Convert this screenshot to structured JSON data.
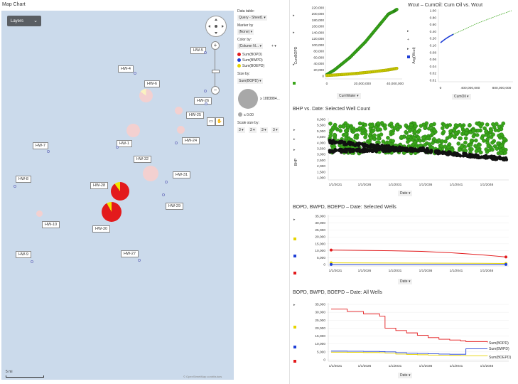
{
  "map": {
    "title": "Map Chart",
    "layers_label": "Layers",
    "scale_label": "5 mi",
    "credit": "© OpenStreetMap contributors",
    "wells": [
      {
        "id": "w5",
        "label": "HW-5"
      },
      {
        "id": "w4",
        "label": "HW-4"
      },
      {
        "id": "w6",
        "label": "HW-6"
      },
      {
        "id": "w26",
        "label": "HW-26"
      },
      {
        "id": "w25",
        "label": "HW-25"
      },
      {
        "id": "w1",
        "label": "HW-1"
      },
      {
        "id": "w7",
        "label": "HW-7"
      },
      {
        "id": "w24",
        "label": "HW-24"
      },
      {
        "id": "w32",
        "label": "HW-32"
      },
      {
        "id": "w31",
        "label": "HW-31"
      },
      {
        "id": "w8",
        "label": "HW-8"
      },
      {
        "id": "w28",
        "label": "HW-28"
      },
      {
        "id": "w29",
        "label": "HW-29"
      },
      {
        "id": "w10",
        "label": "HW-10"
      },
      {
        "id": "w30",
        "label": "HW-30"
      },
      {
        "id": "w9",
        "label": "HW-9"
      },
      {
        "id": "w27",
        "label": "HW-27"
      }
    ]
  },
  "legend": {
    "data_table_head": "Data table:",
    "data_table_value": "Query - Sheet1 ▾",
    "marker_head": "Marker by",
    "marker_value": "(None) ▾",
    "color_head": "Color by:",
    "color_value": "(Column N... ▾",
    "color_plus": "+ ▾",
    "color_items": [
      {
        "label": "Sum(BOPD)",
        "color": "#e31a1c"
      },
      {
        "label": "Sum(BWPD)",
        "color": "#1f3fd6"
      },
      {
        "label": "Sum(BOEPD)",
        "color": "#e6d400"
      }
    ],
    "size_head": "Size by:",
    "size_value": "Sum(BOPD) ▾",
    "size_max": "≥ 1883884...",
    "size_min": "≤ 0.00",
    "scale_head": "Scale size by:",
    "scale_values": [
      "3 ▾",
      "3 ▾",
      "3 ▾",
      "3 ▾"
    ]
  },
  "cum_chart": {
    "y_axis_label": "CumBOPD",
    "y_ticks": [
      "220,000",
      "200,000",
      "180,000",
      "160,000",
      "140,000",
      "120,000",
      "100,000",
      "80,000",
      "60,000",
      "40,000",
      "20,000",
      "0"
    ],
    "x_ticks": [
      "0",
      "20,000,000",
      "40,000,000"
    ],
    "x_selector": "CumWater ▾"
  },
  "wcut_chart": {
    "title": "Wcut – CumOil: Cum Oil vs. Wcut",
    "y_axis_label": "Avg(Wcut)",
    "y_ticks": [
      "1.00",
      "0.80",
      "0.60",
      "0.40",
      "0.20",
      "0.10",
      "0.08",
      "0.06",
      "0.04",
      "0.02",
      "0.01"
    ],
    "x_ticks": [
      "0",
      "400,000,000",
      "800,000,000"
    ],
    "x_selector": "CumOil ▾"
  },
  "bhp_chart": {
    "title": "BHP vs. Date: Selected Well Count",
    "y_axis_label": "BHP",
    "y_ticks": [
      "6,000",
      "5,500",
      "5,000",
      "4,500",
      "4,000",
      "3,500",
      "3,000",
      "2,500",
      "2,000",
      "1,500",
      "1,000"
    ],
    "x_ticks": [
      "1/1/2021",
      "1/1/2026",
      "1/1/2031",
      "1/1/2036",
      "1/1/2041",
      "1/1/2046"
    ],
    "x_selector": "Date ▾"
  },
  "selected_chart": {
    "title": "BOPD, BWPD, BOEPD – Date: Selected Wells",
    "y_ticks": [
      "35,000",
      "30,000",
      "25,000",
      "20,000",
      "15,000",
      "10,000",
      "5,000",
      "0"
    ],
    "x_ticks": [
      "1/1/2021",
      "1/1/2026",
      "1/1/2031",
      "1/1/2036",
      "1/1/2041",
      "1/1/2046"
    ],
    "x_selector": "Date ▾"
  },
  "all_chart": {
    "title": "BOPD, BWPD, BOEPD – Date: All Wells",
    "y_ticks": [
      "35,000",
      "30,000",
      "25,000",
      "20,000",
      "15,000",
      "10,000",
      "5,000",
      "0"
    ],
    "x_ticks": [
      "1/1/2021",
      "1/1/2026",
      "1/1/2031",
      "1/1/2036",
      "1/1/2041",
      "1/1/2046"
    ],
    "x_selector": "Date ▾",
    "series_labels": [
      "Sum(BOPD)",
      "Sum(BWPD)",
      "Sum(BOEPD)"
    ]
  },
  "colors": {
    "bopd": "#e31a1c",
    "bwpd": "#1f3fd6",
    "boepd": "#e6d400",
    "green": "#3aa61a"
  },
  "chart_data": [
    {
      "type": "scatter",
      "xlabel": "CumWater",
      "ylabel": "CumBOPD",
      "xlim": [
        0,
        48000000
      ],
      "ylim": [
        0,
        220000
      ],
      "series": [
        {
          "color": "#3aa61a",
          "x": [
            0,
            5000000,
            10000000,
            15000000,
            20000000,
            25000000,
            30000000,
            35000000,
            40000000,
            44000000,
            45500000
          ],
          "y": [
            5000,
            20000,
            40000,
            60000,
            85000,
            110000,
            140000,
            170000,
            200000,
            210000,
            215000
          ]
        },
        {
          "color": "#c8c800",
          "x": [
            0,
            10000000,
            20000000,
            30000000,
            40000000,
            45500000
          ],
          "y": [
            2000,
            5000,
            9000,
            14000,
            20000,
            25000
          ]
        }
      ]
    },
    {
      "type": "scatter",
      "xlabel": "CumOil",
      "ylabel": "Avg(Wcut)",
      "xlim": [
        0,
        1000000000
      ],
      "ylim": [
        0.01,
        1
      ],
      "yscale": "log",
      "series": [
        {
          "color": "#1f3fd6",
          "x": [
            0,
            20000000,
            60000000,
            100000000,
            140000000,
            180000000
          ],
          "y": [
            0.12,
            0.13,
            0.15,
            0.17,
            0.19,
            0.21
          ]
        },
        {
          "color": "#3aa61a",
          "x": [
            180000000,
            350000000,
            500000000,
            650000000,
            800000000,
            1000000000
          ],
          "y": [
            0.21,
            0.3,
            0.42,
            0.55,
            0.72,
            1.0
          ]
        }
      ]
    },
    {
      "type": "scatter",
      "xlabel": "Date",
      "ylabel": "BHP",
      "ylim": [
        1000,
        6000
      ],
      "series": [
        {
          "color": "#3aa61a",
          "band": [
            3100,
            5700
          ]
        },
        {
          "color": "#111111",
          "band": [
            2400,
            4200
          ]
        }
      ]
    },
    {
      "type": "line",
      "xlabel": "Date",
      "ylim": [
        0,
        35000
      ],
      "x": [
        2021,
        2031,
        2036,
        2041,
        2046,
        2050
      ],
      "series": [
        {
          "color": "#e31a1c",
          "values": [
            10500,
            10000,
            9500,
            8500,
            7000,
            5500
          ]
        },
        {
          "color": "#e6d400",
          "values": [
            1200,
            1100,
            1000,
            950,
            900,
            800
          ]
        },
        {
          "color": "#1f3fd6",
          "values": [
            50,
            50,
            50,
            50,
            50,
            50
          ]
        }
      ]
    },
    {
      "type": "line",
      "xlabel": "Date",
      "ylim": [
        0,
        35000
      ],
      "x": [
        2021,
        2024,
        2027,
        2030,
        2031,
        2033,
        2035,
        2037,
        2039,
        2041,
        2043,
        2045,
        2046,
        2050
      ],
      "series": [
        {
          "name": "Sum(BOPD)",
          "color": "#e31a1c",
          "values": [
            32000,
            30500,
            29000,
            27500,
            20000,
            18500,
            17000,
            15500,
            14000,
            13000,
            12500,
            12000,
            11500,
            11000
          ]
        },
        {
          "name": "Sum(BWPD)",
          "color": "#1f3fd6",
          "values": [
            5500,
            5400,
            5300,
            5200,
            5000,
            4500,
            4200,
            4000,
            3800,
            3600,
            3500,
            3500,
            7000,
            7000
          ]
        },
        {
          "name": "Sum(BOEPD)",
          "color": "#e6d400",
          "values": [
            4800,
            4700,
            4600,
            4500,
            4300,
            3600,
            3400,
            3200,
            3000,
            2900,
            2800,
            2700,
            2600,
            2500
          ]
        }
      ]
    }
  ]
}
